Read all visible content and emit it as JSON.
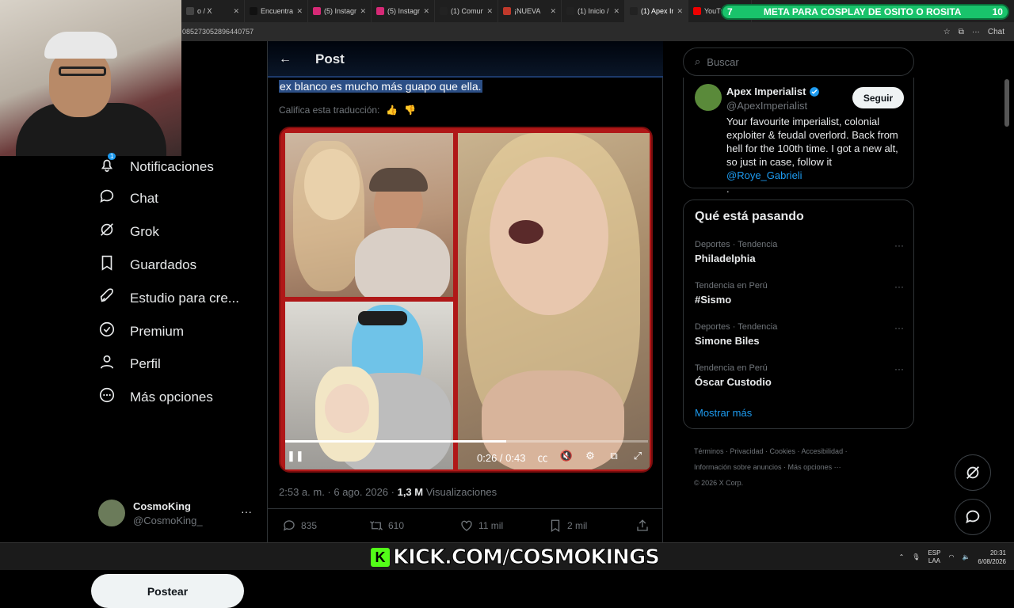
{
  "browser": {
    "tabs": [
      {
        "label": "o / X",
        "color": "#444"
      },
      {
        "label": "Encuentra",
        "color": "#111"
      },
      {
        "label": "(5) Instagra",
        "color": "#d62976"
      },
      {
        "label": "(5) Instagra",
        "color": "#d62976"
      },
      {
        "label": "(1) Comun",
        "color": "#222"
      },
      {
        "label": "¡NUEVA",
        "color": "#c0392b"
      },
      {
        "label": "(1) Inicio / X",
        "color": "#222"
      },
      {
        "label": "(1) Apex Im",
        "color": "#222"
      },
      {
        "label": "YouTube",
        "color": "#e00"
      }
    ],
    "url": "085273052896440757",
    "toolbar_chat": "Chat"
  },
  "banner": {
    "left": "7",
    "text": "META PARA COSPLAY DE OSITO O ROSITA",
    "right": "10"
  },
  "sidebar": {
    "items": [
      {
        "label": "Notificaciones",
        "icon": "bell-icon",
        "badge": "1"
      },
      {
        "label": "Chat",
        "icon": "chat-icon"
      },
      {
        "label": "Grok",
        "icon": "grok-icon"
      },
      {
        "label": "Guardados",
        "icon": "bookmark-icon"
      },
      {
        "label": "Estudio para cre...",
        "icon": "rocket-icon"
      },
      {
        "label": "Premium",
        "icon": "verified-icon"
      },
      {
        "label": "Perfil",
        "icon": "person-icon"
      },
      {
        "label": "Más opciones",
        "icon": "more-circle-icon"
      }
    ],
    "post_button": "Postear",
    "profile": {
      "name": "CosmoKing",
      "handle": "@CosmoKing_",
      "more": "···"
    }
  },
  "main": {
    "header_title": "Post",
    "translated_text": "ex blanco es mucho más guapo que ella.",
    "rate_translation": "Califica esta traducción:",
    "video": {
      "time": "0:26 / 0:43",
      "progress": 0.61
    },
    "meta_time": "2:53 a. m. · 6 ago. 2026 · ",
    "views_count": "1,3 M",
    "views_label": " Visualizaciones",
    "actions": {
      "replies": "835",
      "reposts": "610",
      "likes": "11 mil",
      "bookmarks": "2 mil"
    }
  },
  "right": {
    "search_placeholder": "Buscar",
    "card": {
      "name": "Apex Imperialist",
      "handle": "@ApexImperialist",
      "follow": "Seguir",
      "bio": "Your favourite imperialist, colonial exploiter & feudal overlord. Back from hell for the 100th time. I got a new alt, so just in case, follow it ",
      "bio_link": "@Roye_Gabrieli",
      "bio_end": "."
    },
    "trends_title": "Qué está pasando",
    "trends": [
      {
        "context": "Deportes · Tendencia",
        "name": "Philadelphia"
      },
      {
        "context": "Tendencia en Perú",
        "name": "#Sismo"
      },
      {
        "context": "Deportes · Tendencia",
        "name": "Simone Biles"
      },
      {
        "context": "Tendencia en Perú",
        "name": "Óscar Custodio"
      }
    ],
    "show_more": "Mostrar más",
    "footer": {
      "line1": "Términos · Privacidad · Cookies · Accesibilidad ·",
      "line2": "Información sobre anuncios · Más opciones ···",
      "line3": "© 2026 X Corp."
    }
  },
  "overlay": {
    "kick_text": "KICK.COM/COSMOKINGS",
    "kick_logo": "K"
  },
  "taskbar": {
    "lang1": "ESP",
    "lang2": "LAA",
    "time": "20:31",
    "date": "6/08/2026"
  }
}
